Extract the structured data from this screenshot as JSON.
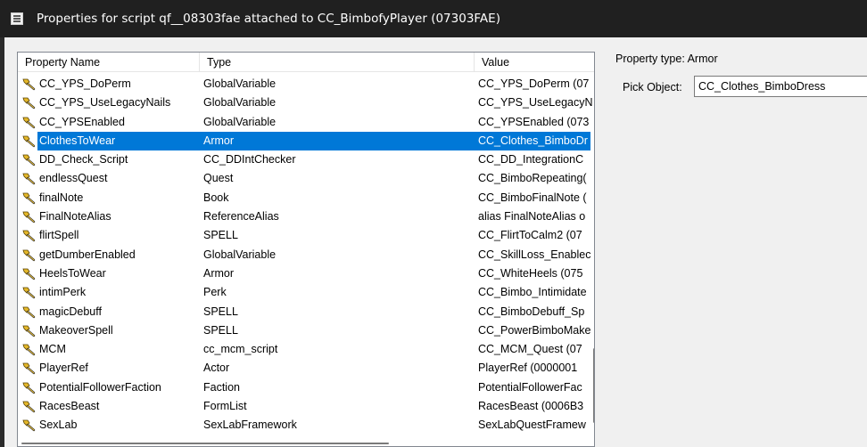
{
  "window": {
    "title": "Properties for script qf__08303fae attached to CC_BimbofyPlayer (07303FAE)"
  },
  "table": {
    "headers": [
      "Property Name",
      "Type",
      "Value"
    ],
    "rows": [
      {
        "name": "CC_YPS_DoPerm",
        "type": "GlobalVariable",
        "value": "CC_YPS_DoPerm (07",
        "selected": false
      },
      {
        "name": "CC_YPS_UseLegacyNails",
        "type": "GlobalVariable",
        "value": "CC_YPS_UseLegacyN",
        "selected": false
      },
      {
        "name": "CC_YPSEnabled",
        "type": "GlobalVariable",
        "value": "CC_YPSEnabled (073",
        "selected": false
      },
      {
        "name": "ClothesToWear",
        "type": "Armor",
        "value": "CC_Clothes_BimboDr",
        "selected": true
      },
      {
        "name": "DD_Check_Script",
        "type": "CC_DDIntChecker",
        "value": "CC_DD_IntegrationC",
        "selected": false
      },
      {
        "name": "endlessQuest",
        "type": "Quest",
        "value": "CC_BimboRepeating(",
        "selected": false
      },
      {
        "name": "finalNote",
        "type": "Book",
        "value": "CC_BimboFinalNote (",
        "selected": false
      },
      {
        "name": "FinalNoteAlias",
        "type": "ReferenceAlias",
        "value": "alias FinalNoteAlias o",
        "selected": false
      },
      {
        "name": "flirtSpell",
        "type": "SPELL",
        "value": "CC_FlirtToCalm2 (07",
        "selected": false
      },
      {
        "name": "getDumberEnabled",
        "type": "GlobalVariable",
        "value": "CC_SkillLoss_Enablec",
        "selected": false
      },
      {
        "name": "HeelsToWear",
        "type": "Armor",
        "value": "CC_WhiteHeels (075",
        "selected": false
      },
      {
        "name": "intimPerk",
        "type": "Perk",
        "value": "CC_Bimbo_Intimidate",
        "selected": false
      },
      {
        "name": "magicDebuff",
        "type": "SPELL",
        "value": "CC_BimboDebuff_Sp",
        "selected": false
      },
      {
        "name": "MakeoverSpell",
        "type": "SPELL",
        "value": "CC_PowerBimboMake",
        "selected": false
      },
      {
        "name": "MCM",
        "type": "cc_mcm_script",
        "value": "CC_MCM_Quest (07",
        "selected": false
      },
      {
        "name": "PlayerRef",
        "type": "Actor",
        "value": "PlayerRef (0000001",
        "selected": false
      },
      {
        "name": "PotentialFollowerFaction",
        "type": "Faction",
        "value": "PotentialFollowerFac",
        "selected": false
      },
      {
        "name": "RacesBeast",
        "type": "FormList",
        "value": "RacesBeast (0006B3",
        "selected": false
      },
      {
        "name": "SexLab",
        "type": "SexLabFramework",
        "value": "SexLabQuestFramew",
        "selected": false
      }
    ]
  },
  "detail": {
    "property_type": "Property type: Armor",
    "pick_label": "Pick Object:",
    "pick_value": "CC_Clothes_BimboDress"
  },
  "icons": {
    "window": "script-window-icon",
    "property": "property-wrench-icon"
  },
  "colors": {
    "selection": "#0078d7",
    "titlebar": "#202020",
    "dialog": "#f0f0f0"
  }
}
